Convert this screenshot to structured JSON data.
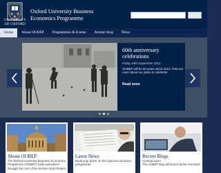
{
  "header": {
    "university_name": "UNIVERSITY OF OXFORD",
    "title_line1": "Oxford University Business",
    "title_line2": "Economics Programme",
    "search": {
      "value": "",
      "placeholder": "",
      "button_label": ""
    }
  },
  "nav": {
    "items": [
      {
        "label": "Home",
        "active": true
      },
      {
        "label": "About OUBEP"
      },
      {
        "label": "Programmes & Events"
      },
      {
        "label": "Alumni blog"
      },
      {
        "label": "News"
      }
    ]
  },
  "carousel": {
    "title": "60th anniversary celebrations",
    "date": "Friday 16th September 2012",
    "text": "OUBEP will be 60 years old in 2012. Find out more about our plans to celebrate",
    "read_more": "Read more",
    "slide_count": 3,
    "active_slide": 2
  },
  "boxes": [
    {
      "title": "About OUBEP",
      "text": "The Oxford University Business Economics Programme (OUBEP) trails executives through the core of Economics and Finance"
    },
    {
      "title": "Latest News",
      "text": "Book your place on the topical economics programme"
    },
    {
      "title": "Recent Blogs",
      "text": "Coming soon!",
      "text2": "The OUBEP blog will launch at the next Mock"
    }
  ],
  "colors": {
    "oxford_blue": "#002147",
    "nav_bg": "#0b2550",
    "page_bg": "#1b2d52",
    "carousel_bg": "#3e4f63"
  }
}
